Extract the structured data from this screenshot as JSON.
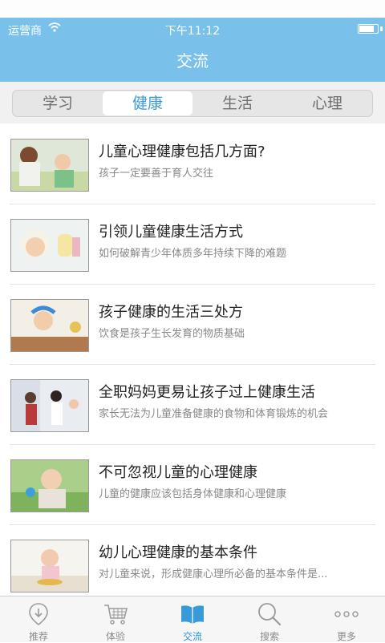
{
  "status_bar": {
    "carrier": "运营商",
    "time": "下午11:12",
    "battery_level": 0.8
  },
  "nav": {
    "title": "交流"
  },
  "segments": [
    {
      "label": "学习",
      "active": false
    },
    {
      "label": "健康",
      "active": true
    },
    {
      "label": "生活",
      "active": false
    },
    {
      "label": "心理",
      "active": false
    }
  ],
  "articles": [
    {
      "title": "儿童心理健康包括几方面?",
      "subtitle": "孩子一定要善于育人交往"
    },
    {
      "title": "引领儿童健康生活方式",
      "subtitle": "如何破解青少年体质多年持续下降的难题"
    },
    {
      "title": "孩子健康的生活三处方",
      "subtitle": "饮食是孩子生长发育的物质基础"
    },
    {
      "title": "全职妈妈更易让孩子过上健康生活",
      "subtitle": "家长无法为儿童准备健康的食物和体育锻炼的机会"
    },
    {
      "title": "不可忽视儿童的心理健康",
      "subtitle": "儿童的健康应该包括身体健康和心理健康"
    },
    {
      "title": "幼儿心理健康的基本条件",
      "subtitle": "对儿童来说，形成健康心理所必备的基本条件是..."
    }
  ],
  "tabbar": [
    {
      "label": "推荐",
      "icon": "location-pin-icon",
      "active": false
    },
    {
      "label": "体验",
      "icon": "cart-icon",
      "active": false
    },
    {
      "label": "交流",
      "icon": "book-icon",
      "active": true
    },
    {
      "label": "搜索",
      "icon": "search-icon",
      "active": false
    },
    {
      "label": "更多",
      "icon": "more-dots-icon",
      "active": false
    }
  ],
  "colors": {
    "header": "#79c0ea",
    "accent": "#2b95d6"
  }
}
